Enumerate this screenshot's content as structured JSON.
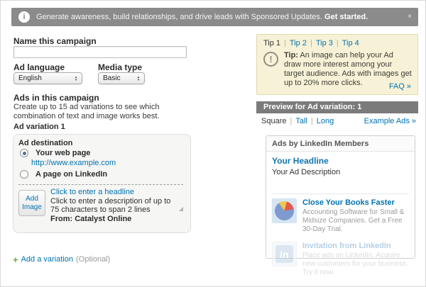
{
  "banner": {
    "text": "Generate awareness, build relationships, and drive leads with Sponsored Updates.",
    "link": "Get started."
  },
  "icons": {
    "info": "i",
    "close": "×",
    "plus": "+",
    "exclamation": "!",
    "resize": "◢",
    "stepper_up": "▴",
    "stepper_down": "▾",
    "separator": "|"
  },
  "form": {
    "name_label": "Name this campaign",
    "name_value": "",
    "ad_language_label": "Ad language",
    "ad_language_value": "English",
    "media_type_label": "Media type",
    "media_type_value": "Basic",
    "ads_heading": "Ads in this campaign",
    "ads_description": "Create up to 15 ad variations to see which combination of text and image works best.",
    "variation_heading": "Ad variation 1",
    "variation": {
      "destination_label": "Ad destination",
      "options": [
        {
          "label": "Your web page",
          "selected": true,
          "link": "http://www.example.com"
        },
        {
          "label": "A page on LinkedIn",
          "selected": false
        }
      ],
      "add_image_label": "Add Image",
      "headline_placeholder": "Click to enter a headline",
      "description_placeholder": "Click to enter a description of up to 75 characters to span 2 lines",
      "from_label": "From: Catalyst Online"
    },
    "add_variation": "Add a variation",
    "add_variation_optional": "(Optional)"
  },
  "tips": {
    "tabs": [
      "Tip 1",
      "Tip 2",
      "Tip 3",
      "Tip 4"
    ],
    "active_tab": "Tip 1",
    "tip_label": "Tip:",
    "tip_text": "An image can help your Ad draw more interest among your target audience. Ads with images get up to 20% more clicks.",
    "faq_link": "FAQ »"
  },
  "preview": {
    "header": "Preview for Ad variation: 1",
    "tabs": [
      "Square",
      "Tall",
      "Long"
    ],
    "active_tab": "Square",
    "example_ads_link": "Example Ads »",
    "box_header": "Ads by LinkedIn Members",
    "your_headline": "Your Headline",
    "your_description": "Your Ad Description",
    "example_ads": [
      {
        "headline": "Close Your Books Faster",
        "description": "Accounting Software for Small & Midsize Companies. Get a Free 30-Day Trial.",
        "image": "pie-chart"
      },
      {
        "headline": "Invitation from LinkedIn",
        "description": "Place ads on LinkedIn. Acquire new customers for your business. Try it now.",
        "image": "linkedin-logo",
        "logo_text": "in",
        "faded": true
      }
    ]
  },
  "colors": {
    "accent_link": "#0073b1",
    "banner_bg": "#8b8b8b",
    "preview_header_bg": "#7b7b7b",
    "tips_bg": "#f7f2d7",
    "tips_border": "#e1d9ae",
    "panel_bg": "#f6f6f5",
    "add_variation_green": "#72ab33"
  }
}
